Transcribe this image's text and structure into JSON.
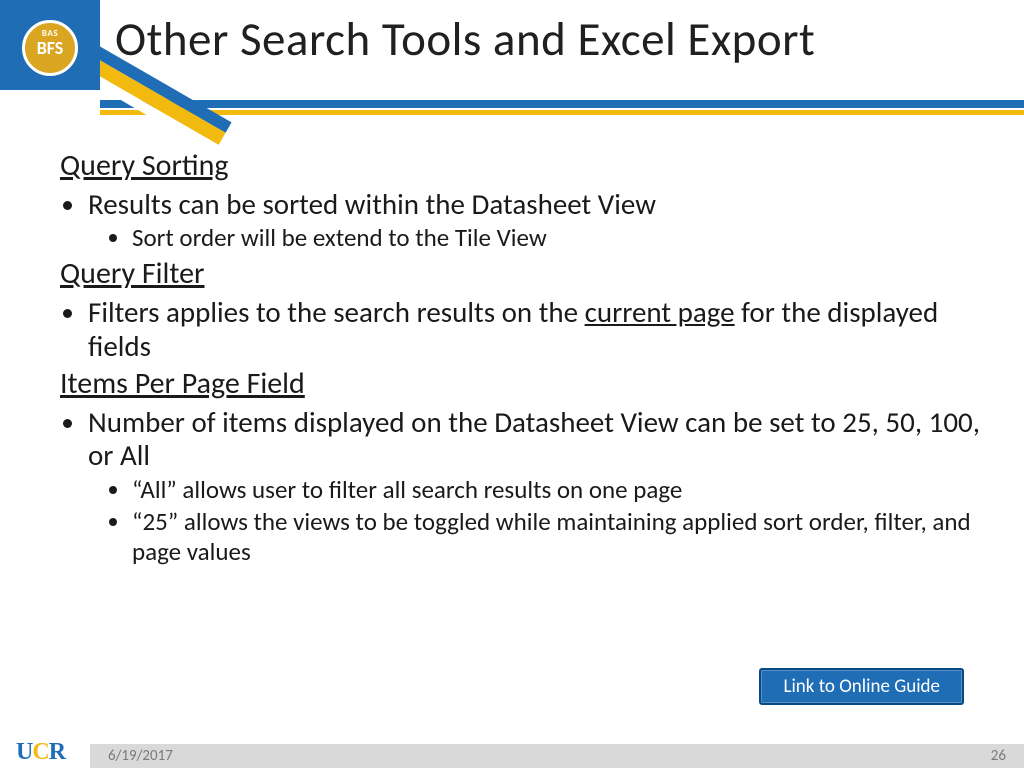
{
  "badge": {
    "small": "BAS",
    "big": "BFS"
  },
  "title": "Other Search Tools and Excel Export",
  "sections": [
    {
      "heading": "Query Sorting",
      "bullets": [
        {
          "text": "Results can be sorted within the Datasheet View",
          "sub": [
            "Sort order will be extend to the Tile View"
          ]
        }
      ]
    },
    {
      "heading": "Query Filter",
      "bullets": [
        {
          "text_pre": "Filters applies to the search results on the ",
          "text_u": "current page",
          "text_post": " for the displayed fields"
        }
      ]
    },
    {
      "heading": "Items Per Page Field",
      "bullets": [
        {
          "text": "Number of items displayed on the Datasheet View can be set to 25, 50, 100, or All",
          "sub": [
            "“All” allows user to filter all search results on one page",
            "“25” allows the views to be toggled while maintaining applied sort order, filter, and page values"
          ]
        }
      ]
    }
  ],
  "link_button": "Link to Online Guide",
  "footer": {
    "date": "6/19/2017",
    "page": "26"
  },
  "logo": {
    "u": "U",
    "c": "C",
    "r": "R"
  }
}
